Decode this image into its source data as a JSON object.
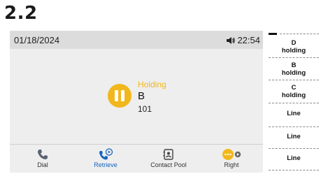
{
  "section": {
    "title": "2.2"
  },
  "status_bar": {
    "date": "01/18/2024",
    "time": "22:54"
  },
  "call": {
    "state": "Holding",
    "name": "B",
    "number": "101",
    "accent": "#f1b71c"
  },
  "softkeys": [
    {
      "label": "Dial",
      "icon": "phone-icon"
    },
    {
      "label": "Retrieve",
      "icon": "retrieve-call-icon",
      "color": "#1565c0"
    },
    {
      "label": "Contact Pool",
      "icon": "contacts-icon"
    },
    {
      "label": "Right",
      "icon": "more-right-icon"
    }
  ],
  "line_keys": [
    {
      "line1": "D",
      "line2": "holding"
    },
    {
      "line1": "B",
      "line2": "holding"
    },
    {
      "line1": "C",
      "line2": "holding"
    },
    {
      "line1": "Line",
      "line2": ""
    },
    {
      "line1": "Line",
      "line2": ""
    },
    {
      "line1": "Line",
      "line2": ""
    }
  ]
}
